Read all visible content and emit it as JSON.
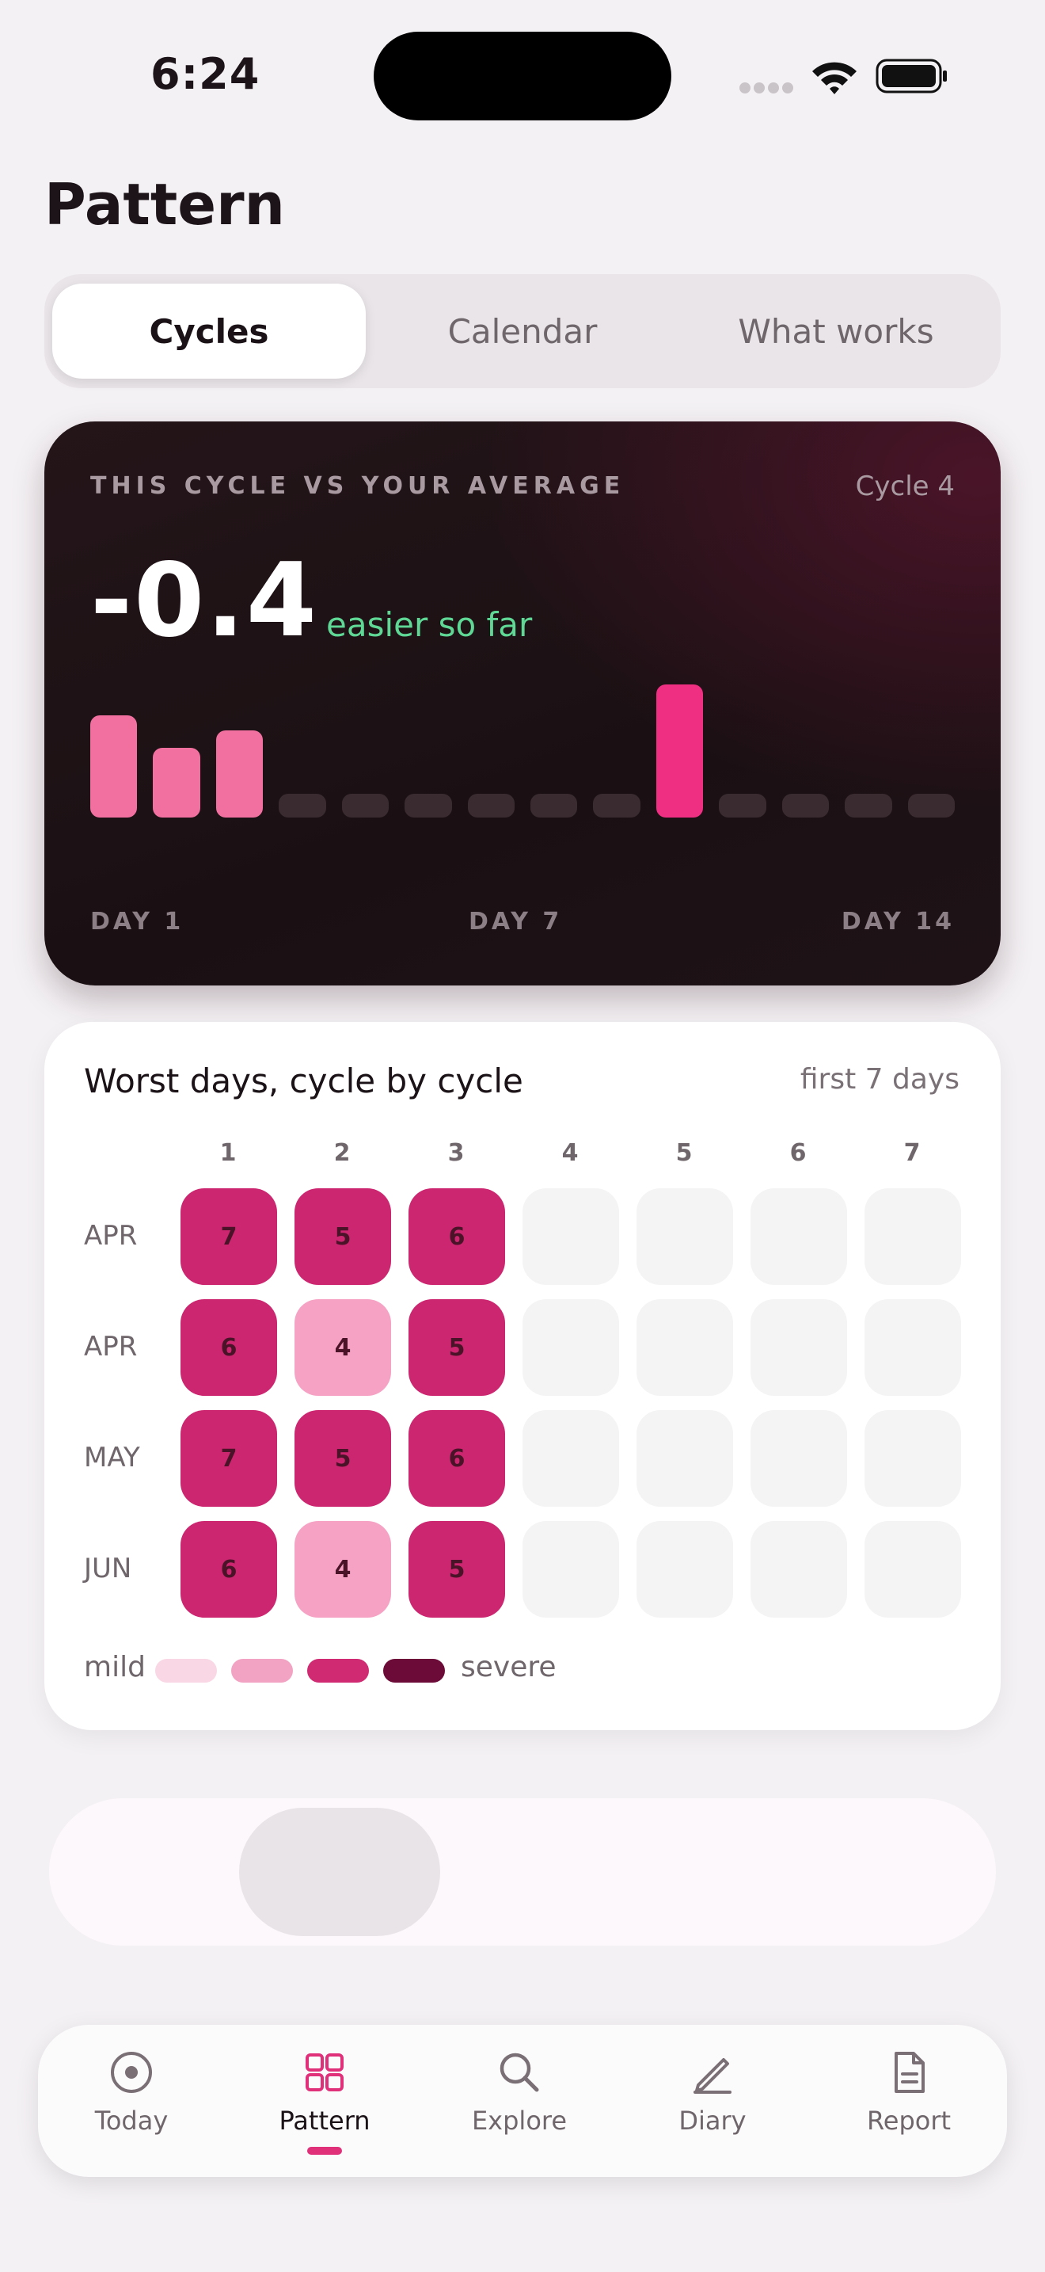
{
  "status_bar": {
    "time": "6:24"
  },
  "page": {
    "title": "Pattern"
  },
  "segmented": {
    "tabs": [
      "Cycles",
      "Calendar",
      "What works"
    ],
    "active_index": 0
  },
  "cycle_card": {
    "label": "THIS CYCLE VS YOUR AVERAGE",
    "cycle": "Cycle 4",
    "delta": "-0.4",
    "delta_caption": "easier so far",
    "day_labels": [
      "DAY 1",
      "DAY 7",
      "DAY 14"
    ],
    "colors": {
      "logged": "#f2709f",
      "highlight": "#ef2f82",
      "empty": "#3a2b31",
      "positive": "#5fd896"
    }
  },
  "chart_data": {
    "type": "bar",
    "categories": [
      1,
      2,
      3,
      4,
      5,
      6,
      7,
      8,
      9,
      10,
      11,
      12,
      13,
      14
    ],
    "values": [
      1.0,
      0.68,
      0.85,
      null,
      null,
      null,
      null,
      null,
      null,
      1.3,
      null,
      null,
      null,
      null
    ],
    "highlight_index": 9,
    "note": ""
  },
  "worst_days": {
    "title": "Worst days, cycle by cycle",
    "subtitle": "first 7 days",
    "columns": [
      "1",
      "2",
      "3",
      "4",
      "5",
      "6",
      "7"
    ],
    "rows": [
      {
        "label": "APR",
        "values": [
          "7",
          "5",
          "6",
          "",
          "",
          "",
          ""
        ]
      },
      {
        "label": "APR",
        "values": [
          "6",
          "4",
          "5",
          "",
          "",
          "",
          ""
        ]
      },
      {
        "label": "MAY",
        "values": [
          "7",
          "5",
          "6",
          "",
          "",
          "",
          ""
        ]
      },
      {
        "label": "JUN",
        "values": [
          "6",
          "4",
          "5",
          "",
          "",
          "",
          ""
        ]
      }
    ],
    "legend": {
      "mild": "mild",
      "severe": "severe",
      "swatches": [
        "#f9d7e4",
        "#f2a3c3",
        "#cf2a72",
        "#6c0b37"
      ]
    },
    "cell_colors": {
      "4": "#f6a2c4",
      "5": "#cc2670",
      "6": "#cc2670",
      "7": "#cc2670"
    }
  },
  "tabbar": {
    "items": [
      {
        "label": "Today",
        "icon": "target-icon"
      },
      {
        "label": "Pattern",
        "icon": "grid-icon"
      },
      {
        "label": "Explore",
        "icon": "search-icon"
      },
      {
        "label": "Diary",
        "icon": "pencil-icon"
      },
      {
        "label": "Report",
        "icon": "document-icon"
      }
    ],
    "active_index": 1,
    "accent": "#e0307a"
  }
}
